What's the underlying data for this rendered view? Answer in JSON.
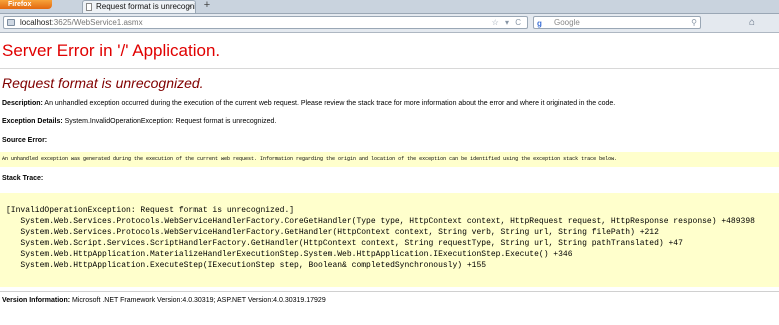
{
  "browser": {
    "menu_label": "Firefox",
    "tab_title": "Request format is unrecognized.",
    "tab_close": "×",
    "new_tab": "+",
    "url_host": "localhost",
    "url_path": ":3625/WebService1.asmx",
    "url_icons": "☆ ▾ C",
    "search_engine": "g",
    "search_placeholder": "Google",
    "search_go": "⚲",
    "home_glyph": "⌂"
  },
  "page": {
    "title": "Server Error in '/' Application.",
    "error_heading": "Request format is unrecognized.",
    "description_label": "Description:",
    "description_text": " An unhandled exception occurred during the execution of the current web request. Please review the stack trace for more information about the error and where it originated in the code.",
    "exception_label": "Exception Details:",
    "exception_text": " System.InvalidOperationException: Request format is unrecognized.",
    "source_label": "Source Error:",
    "source_text": "An unhandled exception was generated during the execution of the current web request. Information regarding the origin and location of the exception can be identified using the exception stack trace below.",
    "stack_label": "Stack Trace:",
    "stack_trace": "[InvalidOperationException: Request format is unrecognized.]\n   System.Web.Services.Protocols.WebServiceHandlerFactory.CoreGetHandler(Type type, HttpContext context, HttpRequest request, HttpResponse response) +489398\n   System.Web.Services.Protocols.WebServiceHandlerFactory.GetHandler(HttpContext context, String verb, String url, String filePath) +212\n   System.Web.Script.Services.ScriptHandlerFactory.GetHandler(HttpContext context, String requestType, String url, String pathTranslated) +47\n   System.Web.HttpApplication.MaterializeHandlerExecutionStep.System.Web.HttpApplication.IExecutionStep.Execute() +346\n   System.Web.HttpApplication.ExecuteStep(IExecutionStep step, Boolean& completedSynchronously) +155",
    "version_label": "Version Information:",
    "version_text": " Microsoft .NET Framework Version:4.0.30319; ASP.NET Version:4.0.30319.17929"
  }
}
